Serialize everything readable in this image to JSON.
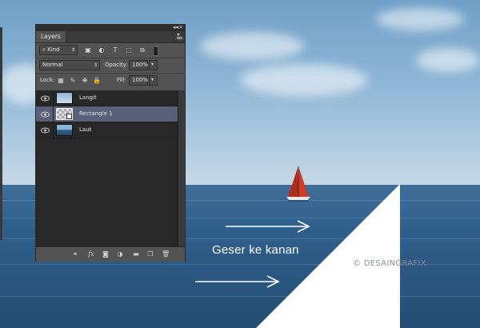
{
  "panel": {
    "tab_title": "Layers",
    "filter_kind": "Kind",
    "blend_mode": "Normal",
    "opacity_label": "Opacity:",
    "opacity_value": "100%",
    "lock_label": "Lock:",
    "fill_label": "Fill:",
    "fill_value": "100%",
    "layers": [
      {
        "name": "Langit",
        "selected": false
      },
      {
        "name": "Rectangle 1",
        "selected": true
      },
      {
        "name": "Laut",
        "selected": false
      }
    ]
  },
  "canvas": {
    "instruction": "Geser ke kanan",
    "watermark": "© DESAINGRAFIX"
  },
  "icons": {
    "visibility": "eye-icon",
    "link": "link-layers-icon",
    "fx": "layer-style-icon",
    "mask": "add-mask-icon",
    "adjustment": "adjustment-layer-icon",
    "group": "folder-icon",
    "new_layer": "new-layer-icon",
    "delete": "trash-icon"
  },
  "colors": {
    "panel_bg": "#535353",
    "list_bg": "#282828",
    "selected_row": "#58607a",
    "sail": "#c8351f"
  }
}
